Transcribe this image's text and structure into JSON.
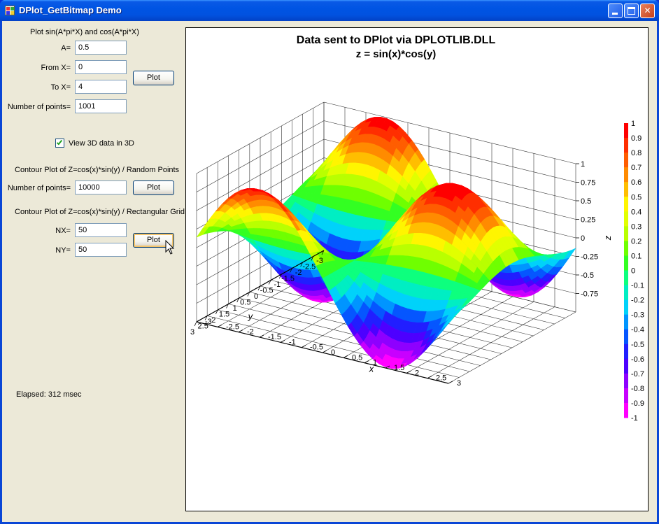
{
  "window": {
    "title": "DPlot_GetBitmap Demo",
    "icon": "app-icon"
  },
  "controls": {
    "group1_label": "Plot sin(A*pi*X) and cos(A*pi*X)",
    "a_label": "A=",
    "a_value": "0.5",
    "from_x_label": "From X=",
    "from_x_value": "0",
    "to_x_label": "To X=",
    "to_x_value": "4",
    "num_points_label": "Number of points=",
    "num_points_value": "1001",
    "plot1_label": "Plot",
    "view3d_label": "View 3D data in 3D",
    "view3d_checked": true,
    "group2_label": "Contour Plot of Z=cos(x)*sin(y) / Random Points",
    "num_points2_label": "Number of points=",
    "num_points2_value": "10000",
    "plot2_label": "Plot",
    "group3_label": "Contour Plot of Z=cos(x)*sin(y) / Rectangular Grid",
    "nx_label": "NX=",
    "nx_value": "50",
    "ny_label": "NY=",
    "ny_value": "50",
    "plot3_label": "Plot",
    "elapsed": "Elapsed: 312 msec"
  },
  "chart_data": {
    "type": "surface3d",
    "title": "Data sent to DPlot via DPLOTLIB.DLL",
    "subtitle": "z = sin(x)*cos(y)",
    "function": "sin(x)*cos(y)",
    "xlabel": "x",
    "ylabel": "y",
    "zlabel": "z",
    "xlim": [
      -3,
      3
    ],
    "ylim": [
      -3,
      3
    ],
    "zlim": [
      -1,
      1
    ],
    "x_ticks": [
      "-3",
      "-2.5",
      "-2",
      "-1.5",
      "-1",
      "-0.5",
      "0",
      "0.5",
      "1",
      "1.5",
      "2",
      "2.5",
      "3"
    ],
    "y_ticks": [
      "3",
      "2.5",
      "2",
      "1.5",
      "1",
      "0.5",
      "0",
      "-0.5",
      "-1",
      "-1.5",
      "-2",
      "-2.5",
      "-3"
    ],
    "z_ticks": [
      "1",
      "0.75",
      "0.5",
      "0.25",
      "0",
      "-0.25",
      "-0.5",
      "-0.75"
    ],
    "colorbar_ticks": [
      "1",
      "0.9",
      "0.8",
      "0.7",
      "0.6",
      "0.5",
      "0.4",
      "0.3",
      "0.2",
      "0.1",
      "0",
      "-0.1",
      "-0.2",
      "-0.3",
      "-0.4",
      "-0.5",
      "-0.6",
      "-0.7",
      "-0.8",
      "-0.9",
      "-1"
    ],
    "colormap": [
      "#ff00ff",
      "#a000ff",
      "#3000ff",
      "#0060ff",
      "#00d0ff",
      "#00ffa0",
      "#40ff00",
      "#c0ff00",
      "#ffff00",
      "#ffa000",
      "#ff5000",
      "#ff0000"
    ],
    "grid": true
  }
}
